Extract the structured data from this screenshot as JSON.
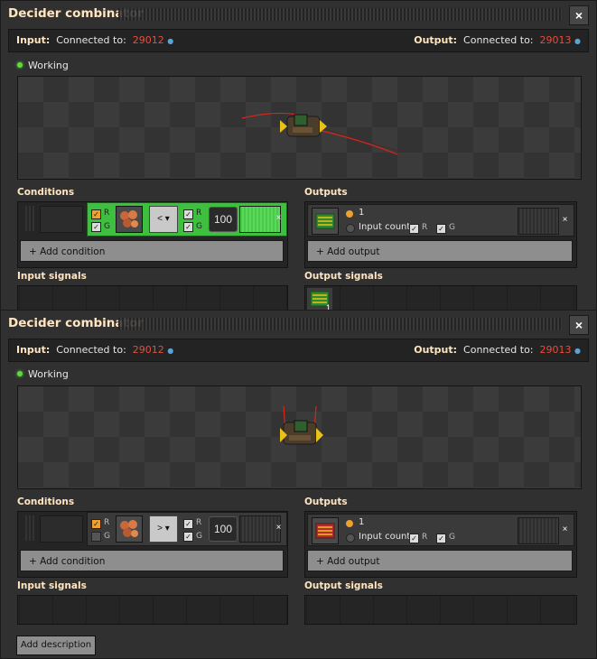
{
  "panels": [
    {
      "title": "Decider combinator",
      "input_label": "Input:",
      "connected_to": "Connected to:",
      "input_id": "29012",
      "output_label": "Output:",
      "output_id": "29013",
      "status": "Working",
      "conditions_label": "Conditions",
      "outputs_label": "Outputs",
      "r": "R",
      "g": "G",
      "comparator": "<",
      "constant": "100",
      "close_row": "×",
      "add_condition": "+ Add condition",
      "output_value": "1",
      "input_count": "Input count",
      "add_output": "+ Add output",
      "input_signals_label": "Input signals",
      "output_signals_label": "Output signals",
      "output_signal_count": "1",
      "condition_highlight": "#3fbf3f"
    },
    {
      "title": "Decider combinator",
      "input_label": "Input:",
      "connected_to": "Connected to:",
      "input_id": "29012",
      "output_label": "Output:",
      "output_id": "29013",
      "status": "Working",
      "conditions_label": "Conditions",
      "outputs_label": "Outputs",
      "r": "R",
      "g": "G",
      "comparator": ">",
      "constant": "100",
      "close_row": "×",
      "add_condition": "+ Add condition",
      "output_value": "1",
      "input_count": "Input count",
      "add_output": "+ Add output",
      "input_signals_label": "Input signals",
      "output_signals_label": "Output signals",
      "add_description": "Add description"
    }
  ],
  "icons": {
    "close": "close-icon",
    "info": "info-icon",
    "status": "status-dot-icon",
    "copper_ore": "copper-ore-icon",
    "circuit": "electronic-circuit-icon",
    "checkbox": "checkmark-icon",
    "dropdown": "chevron-down-icon"
  },
  "colors": {
    "title": "#ffe6c0",
    "network_id": "#e84c3d",
    "working": "#5edb3a",
    "red_wire": "#d9261c"
  }
}
